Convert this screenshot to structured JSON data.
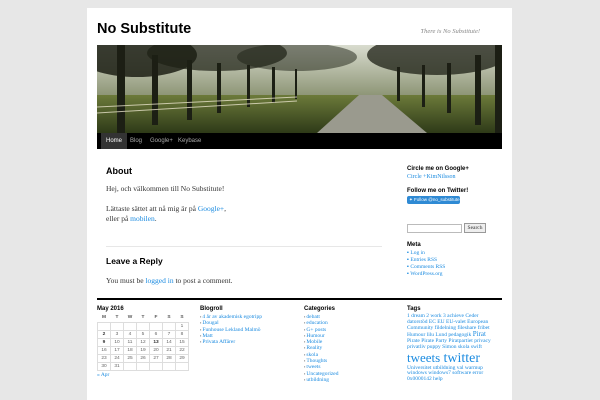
{
  "site": {
    "title": "No Substitute",
    "tagline": "There is No Substitute!"
  },
  "nav": {
    "items": [
      "Home",
      "Blog",
      "Google+",
      "Keybase"
    ]
  },
  "about": {
    "heading": "About",
    "greeting": "Hej, och välkommen till No Substitute!",
    "contact_pre": "Lättaste sättet att nå mig är på ",
    "contact_link1": "Google+",
    "contact_mid": ",",
    "contact_line2_pre": "eller på ",
    "contact_link2": "mobilen",
    "contact_end": "."
  },
  "reply": {
    "heading": "Leave a Reply",
    "text_pre": "You must be ",
    "text_link": "logged in",
    "text_post": " to post a comment."
  },
  "sidebar": {
    "gplus_heading": "Circle me on Google+",
    "gplus_link": "Circle +KimNilsson",
    "twitter_heading": "Follow me on Twitter!",
    "twitter_button": "Follow @no_substitute",
    "search_button": "Search",
    "search_value": "",
    "meta_heading": "Meta",
    "meta_links": [
      "Log in",
      "Entries RSS",
      "Comments RSS",
      "WordPress.org"
    ]
  },
  "calendar": {
    "caption": "May 2016",
    "days": [
      "M",
      "T",
      "W",
      "T",
      "F",
      "S",
      "S"
    ],
    "rows": [
      [
        "",
        "",
        "",
        "",
        "",
        "",
        "1"
      ],
      [
        "2",
        "3",
        "4",
        "5",
        "6",
        "7",
        "8"
      ],
      [
        "9",
        "10",
        "11",
        "12",
        "13",
        "14",
        "15"
      ],
      [
        "16",
        "17",
        "18",
        "19",
        "20",
        "21",
        "22"
      ],
      [
        "23",
        "24",
        "25",
        "26",
        "27",
        "28",
        "29"
      ],
      [
        "30",
        "31",
        "",
        "",
        "",
        "",
        ""
      ]
    ],
    "prev": "« Apr"
  },
  "blogroll": {
    "heading": "Blogroll",
    "items": [
      "4 år av akademisk egotripp",
      "Dougal",
      "Funhouse Lekland Malmö",
      "Matt",
      "Privata Affärer"
    ]
  },
  "categories": {
    "heading": "Categories",
    "items": [
      "debatt",
      "education",
      "G+ posts",
      "Humour",
      "Mobile",
      "Reality",
      "skola",
      "Thoughts",
      "tweets",
      "Uncategorized",
      "utbildning"
    ]
  },
  "tags": {
    "heading": "Tags",
    "line1": "1 dream 2 work 3 achieve Ceder",
    "line2": "datorstöd EC EU EU-valet European",
    "line3": "Community fildelning fileshare fribet",
    "line4": "Humour lilu Lund pedagogik",
    "big1": "Pirat",
    "line5": "Pirate Pirate Party Piratpartiet privacy",
    "line6": "privatliv puppy Simon skola swift",
    "big2": "tweets",
    "big3": "twitter",
    "line7": "Universitet utbildning val warmup",
    "line8": "windows windows7 software error",
    "line9": "0x0000142 help"
  }
}
